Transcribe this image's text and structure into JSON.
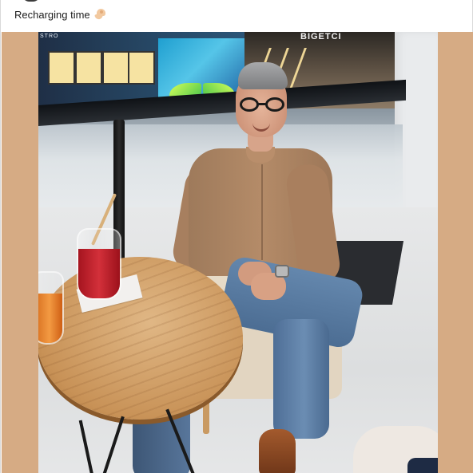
{
  "post": {
    "caption": "Recharging time",
    "caption_emoji_name": "flexed-biceps-emoji"
  },
  "photo": {
    "alt_visible_sign_left": "STRO",
    "alt_visible_sign_right": "BIGETCI",
    "background_color": "#d6ab84"
  }
}
